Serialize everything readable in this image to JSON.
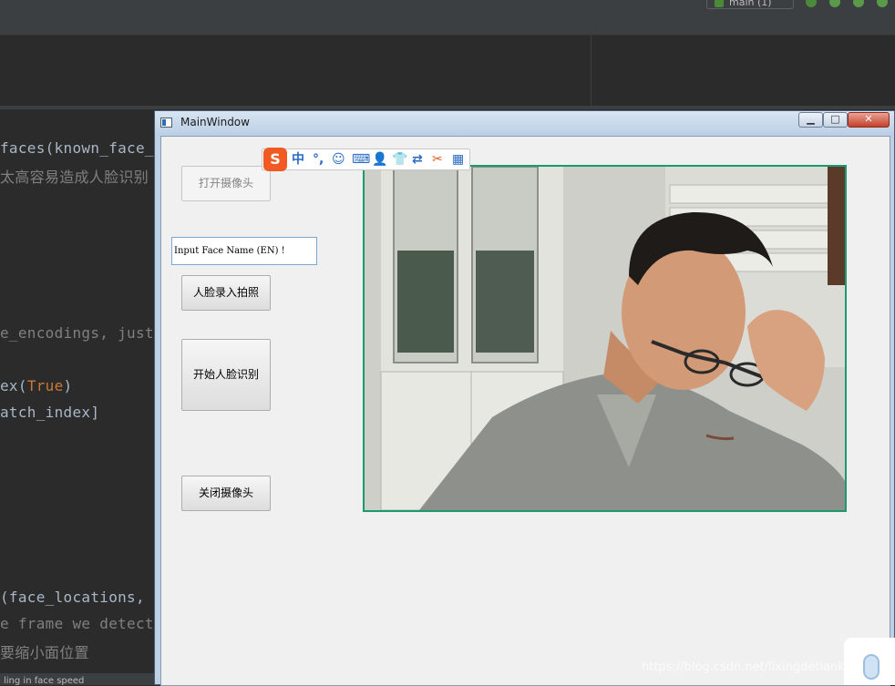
{
  "ide": {
    "run_config": "main (1)",
    "code_lines": [
      {
        "text": "faces(known_face_",
        "kind": "code"
      },
      {
        "text": "太高容易造成人脸识别",
        "kind": "comment"
      },
      {
        "text": "e_encodings, just",
        "kind": "comment"
      },
      {
        "text": "ex(",
        "kw": "True",
        "tail": ")",
        "kind": "code"
      },
      {
        "text": "atch_index]",
        "kind": "code"
      },
      {
        "text": "(face_locations, ",
        "kind": "code"
      },
      {
        "text": "e frame we detect",
        "kind": "comment"
      },
      {
        "text": "要缩小面位置",
        "kind": "comment"
      }
    ],
    "status_text": "ling in face speed"
  },
  "window": {
    "title": "MainWindow",
    "minimize_glyph": "▁",
    "maximize_glyph": "□",
    "close_glyph": "✕"
  },
  "controls": {
    "open_camera": "打开摄像头",
    "name_input_value": "Input Face Name (EN) !",
    "enroll_photo": "人脸录入拍照",
    "start_recognition": "开始人脸识别",
    "close_camera": "关闭摄像头"
  },
  "camera": {
    "description_icon": "webcam-feed"
  },
  "ime": {
    "logo": "S",
    "items": [
      "中",
      "°,",
      "☺",
      "⌨",
      "👤",
      "👕",
      "⇄",
      "✂",
      "▦"
    ]
  },
  "watermark": "https://blog.csdn.net/lixingdetiankong1",
  "colors": {
    "camera_border": "#1a9a6e",
    "ide_bg": "#2b2b2b",
    "qt_client_bg": "#f0f0f0",
    "keyword": "#cc7832"
  }
}
